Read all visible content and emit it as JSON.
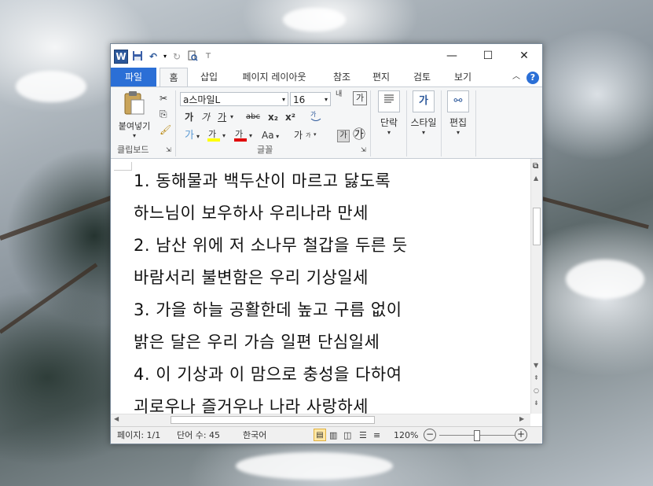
{
  "window": {
    "minimize": "—",
    "maximize": "☐",
    "close": "✕"
  },
  "qat": {
    "app_icon": "W",
    "save_icon": "save-icon",
    "undo_icon": "undo-icon",
    "redo_icon": "redo-icon",
    "preview_icon": "print-preview-icon"
  },
  "tabs": [
    {
      "label": "파일"
    },
    {
      "label": "홈"
    },
    {
      "label": "삽입"
    },
    {
      "label": "페이지 레이아웃"
    },
    {
      "label": "참조"
    },
    {
      "label": "편지"
    },
    {
      "label": "검토"
    },
    {
      "label": "보기"
    }
  ],
  "ribbon": {
    "clipboard": {
      "paste_label": "붙여넣기",
      "group_label": "클립보드"
    },
    "font": {
      "name": "a스마일L",
      "size": "16",
      "group_label": "글꼴",
      "bold": "가",
      "italic": "가",
      "underline": "가",
      "strike": "abc",
      "subscript": "x₂",
      "superscript": "x²",
      "font_color": "가",
      "case": "Aa",
      "grow_label": "내",
      "clear": "가",
      "phonetic": "가",
      "enclosed": "㉮"
    },
    "paragraph": {
      "label": "단락"
    },
    "styles": {
      "label": "스타일"
    },
    "editing": {
      "label": "편집"
    }
  },
  "document": {
    "lines": [
      "1. 동해물과 백두산이 마르고 닳도록",
      "하느님이 보우하사 우리나라 만세",
      "2. 남산 위에 저 소나무 철갑을 두른 듯",
      "바람서리 불변함은 우리 기상일세",
      "3. 가을 하늘 공활한데 높고 구름 없이",
      "밝은 달은 우리 가슴 일편 단심일세",
      "4. 이 기상과 이 맘으로 충성을 다하여",
      "괴로우나 즐거우나 나라 사랑하세"
    ]
  },
  "statusbar": {
    "page": "페이지: 1/1",
    "words": "단어 수: 45",
    "language": "한국어",
    "zoom": "120%"
  }
}
